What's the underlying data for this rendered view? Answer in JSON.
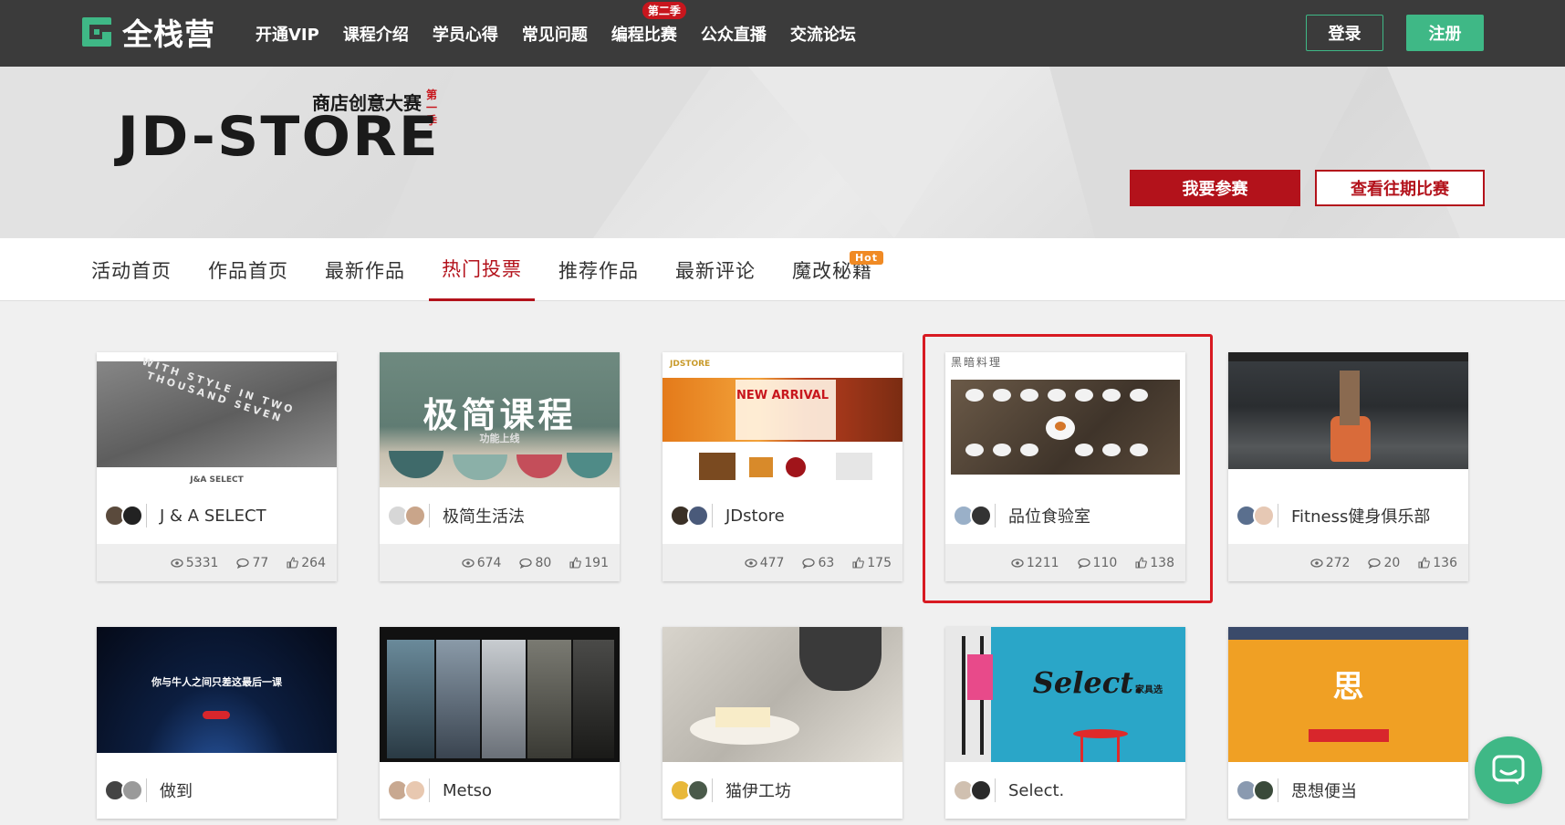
{
  "header": {
    "logo_text": "全栈营",
    "nav": [
      {
        "label": "开通VIP"
      },
      {
        "label": "课程介绍"
      },
      {
        "label": "学员心得"
      },
      {
        "label": "常见问题"
      },
      {
        "label": "编程比赛",
        "badge": "第二季"
      },
      {
        "label": "公众直播"
      },
      {
        "label": "交流论坛"
      }
    ],
    "login_label": "登录",
    "register_label": "注册",
    "brand_color": "#3fb886"
  },
  "banner": {
    "title": "JD-STORE",
    "subtitle": "商店创意大赛",
    "season": "第一季",
    "join_label": "我要参赛",
    "past_label": "查看往期比赛",
    "accent_color": "#b3121b"
  },
  "tabs": [
    {
      "label": "活动首页"
    },
    {
      "label": "作品首页"
    },
    {
      "label": "最新作品"
    },
    {
      "label": "热门投票",
      "active": true
    },
    {
      "label": "推荐作品"
    },
    {
      "label": "最新评论"
    },
    {
      "label": "魔改秘籍",
      "badge": "Hot"
    }
  ],
  "cards": [
    {
      "title": "J & A SELECT",
      "views": "5331",
      "comments": "77",
      "likes": "264",
      "thumb_text": "WITH STYLE IN TWO THOUSAND SEVEN",
      "thumb_sub": "J&A SELECT"
    },
    {
      "title": "极简生活法",
      "views": "674",
      "comments": "80",
      "likes": "191",
      "thumb_text": "极简课程",
      "thumb_sub": "功能上线"
    },
    {
      "title": "JDstore",
      "views": "477",
      "comments": "63",
      "likes": "175",
      "thumb_text": "NEW ARRIVAL",
      "thumb_sub": "JDSTORE"
    },
    {
      "title": "品位食验室",
      "views": "1211",
      "comments": "110",
      "likes": "138",
      "thumb_text": "黑暗料理",
      "thumb_sub": ""
    },
    {
      "title": "Fitness健身俱乐部",
      "views": "272",
      "comments": "20",
      "likes": "136",
      "thumb_text": "",
      "thumb_sub": ""
    },
    {
      "title": "做到",
      "thumb_text": "你与牛人之间只差这最后一课",
      "thumb_sub": ""
    },
    {
      "title": "Metso",
      "thumb_text": "",
      "thumb_sub": ""
    },
    {
      "title": "猫伊工坊",
      "thumb_text": "",
      "thumb_sub": ""
    },
    {
      "title": "Select.",
      "thumb_text": "Select.",
      "thumb_sub": "家具选"
    },
    {
      "title": "思想便当",
      "thumb_text": "思",
      "thumb_sub": ""
    }
  ]
}
